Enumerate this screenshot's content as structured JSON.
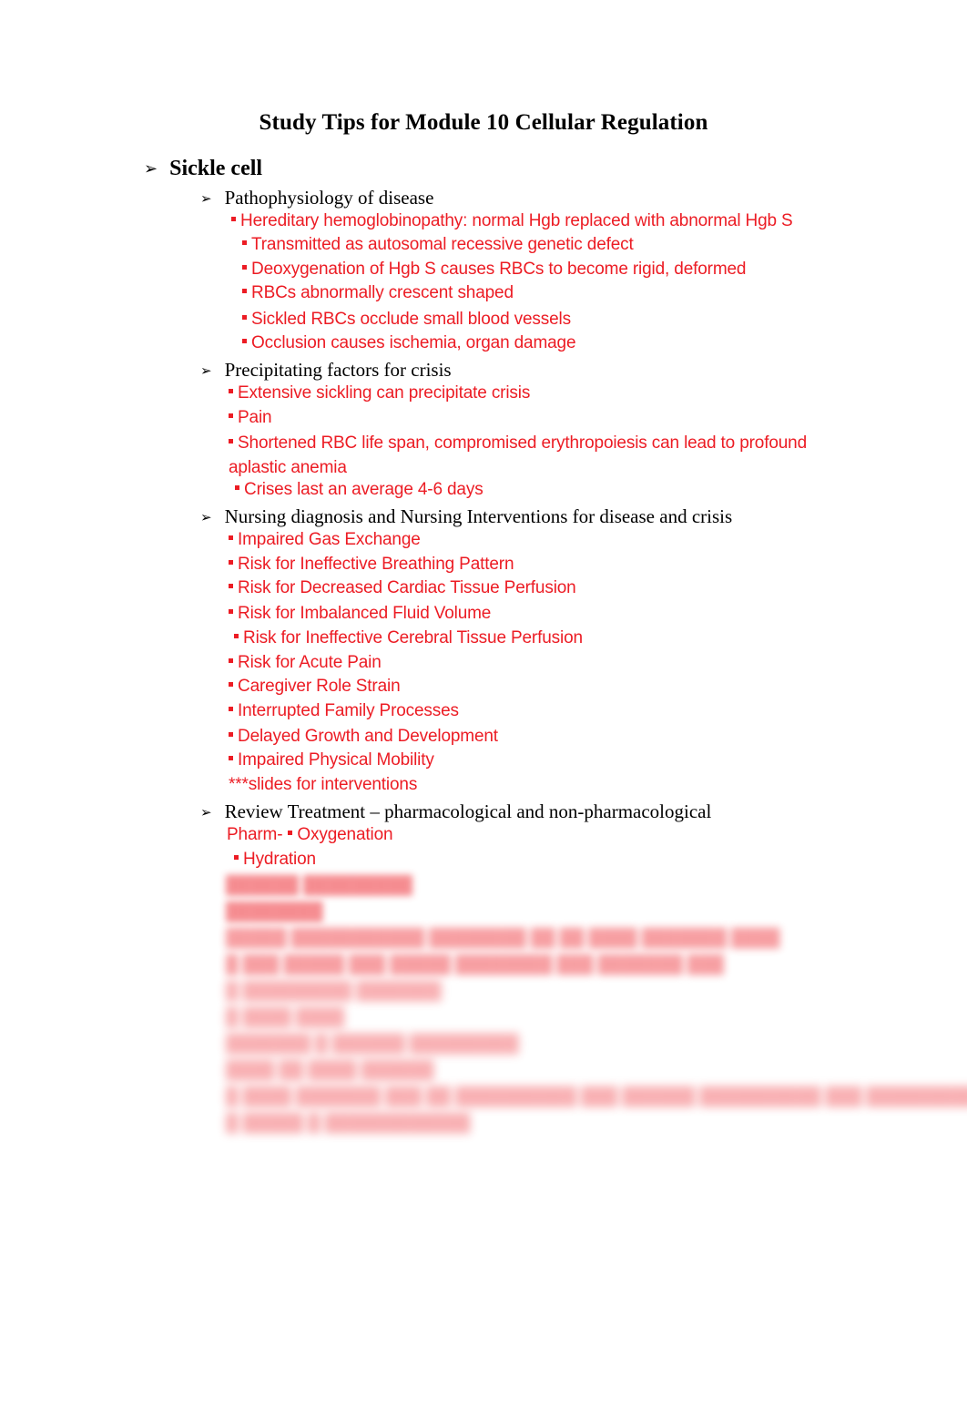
{
  "document": {
    "title": "Study Tips for Module 10 Cellular Regulation",
    "bullet_glyphs": {
      "arrow": "➢",
      "square": "▪"
    },
    "colors": {
      "heading_text": "#000000",
      "body_red": "#ec1c24",
      "page_background": "#ffffff"
    }
  },
  "sections": {
    "sickle_cell": {
      "heading": "Sickle cell",
      "pathophysiology": {
        "heading": "Pathophysiology of disease",
        "items": [
          "Hereditary hemoglobinopathy: normal Hgb replaced with abnormal Hgb S",
          "Transmitted as autosomal recessive genetic defect",
          "Deoxygenation of Hgb S causes RBCs to become rigid, deformed",
          "RBCs abnormally crescent shaped",
          "Sickled RBCs occlude small blood vessels",
          "Occlusion causes ischemia, organ damage"
        ]
      },
      "precipitating_factors": {
        "heading": "Precipitating factors for crisis",
        "items": [
          "Extensive sickling can precipitate crisis",
          "Pain",
          "Shortened RBC life span, compromised erythropoiesis can lead to profound aplastic anemia",
          "Crises last an average 4-6 days"
        ]
      },
      "nursing": {
        "heading": "Nursing diagnosis and Nursing Interventions for disease and crisis",
        "items": [
          "Impaired Gas Exchange",
          "Risk for Ineffective Breathing Pattern",
          "Risk for Decreased Cardiac Tissue Perfusion",
          "Risk for Imbalanced Fluid Volume",
          "Risk for Ineffective Cerebral Tissue Perfusion",
          "Risk for Acute Pain",
          "Caregiver Role Strain",
          "Interrupted Family Processes",
          "Delayed Growth and Development",
          "Impaired Physical Mobility"
        ],
        "note": "***slides for interventions"
      },
      "treatment": {
        "heading": "Review Treatment – pharmacological and non-pharmacological",
        "pharm_label": "Pharm-",
        "items": [
          "Oxygenation",
          "Hydration"
        ]
      }
    }
  },
  "obscured": {
    "note": "blurred-illegible-content",
    "lines": [
      "██████ █████████",
      "████████",
      "█████ ███████████ ████████ ██ ██ ████ ███████ ████",
      "█ ███ █████ ███ █████ ████████ ███ ███████ ███",
      "█ █████████ ███████",
      "█ ████ ████",
      "███████ █ ██████ █████████",
      "████ ██ ████ ██████",
      "█ ████ ███████ ███ ██ ██████████ ███ ██████ ██████████ ███ █████████",
      "█ █████ █ ████████████"
    ]
  }
}
